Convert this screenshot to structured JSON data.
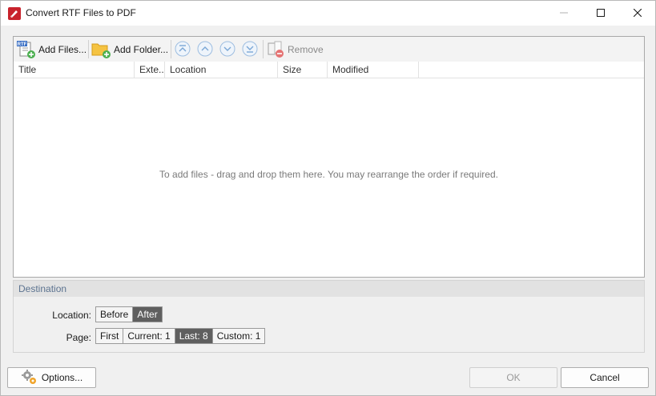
{
  "window": {
    "title": "Convert RTF Files to PDF"
  },
  "toolbar": {
    "add_files": "Add Files...",
    "add_folder": "Add Folder...",
    "remove": "Remove",
    "rtf_badge": "RTF"
  },
  "columns": [
    "Title",
    "Exte..",
    "Location",
    "Size",
    "Modified"
  ],
  "file_list": {
    "empty_hint": "To add files - drag and drop them here. You may rearrange the order if required."
  },
  "destination": {
    "header": "Destination",
    "location_label": "Location:",
    "location_options": [
      {
        "label": "Before",
        "selected": false
      },
      {
        "label": "After",
        "selected": true
      }
    ],
    "page_label": "Page:",
    "page_options": [
      {
        "label": "First",
        "selected": false
      },
      {
        "label": "Current: 1",
        "selected": false
      },
      {
        "label": "Last: 8",
        "selected": true
      },
      {
        "label": "Custom: 1",
        "selected": false
      }
    ]
  },
  "buttons": {
    "options": "Options...",
    "ok": "OK",
    "cancel": "Cancel"
  },
  "colors": {
    "accent_selected": "#5f5f5f",
    "group_header_text": "#5c7390",
    "nav_arrow": "#7aa7d6"
  }
}
